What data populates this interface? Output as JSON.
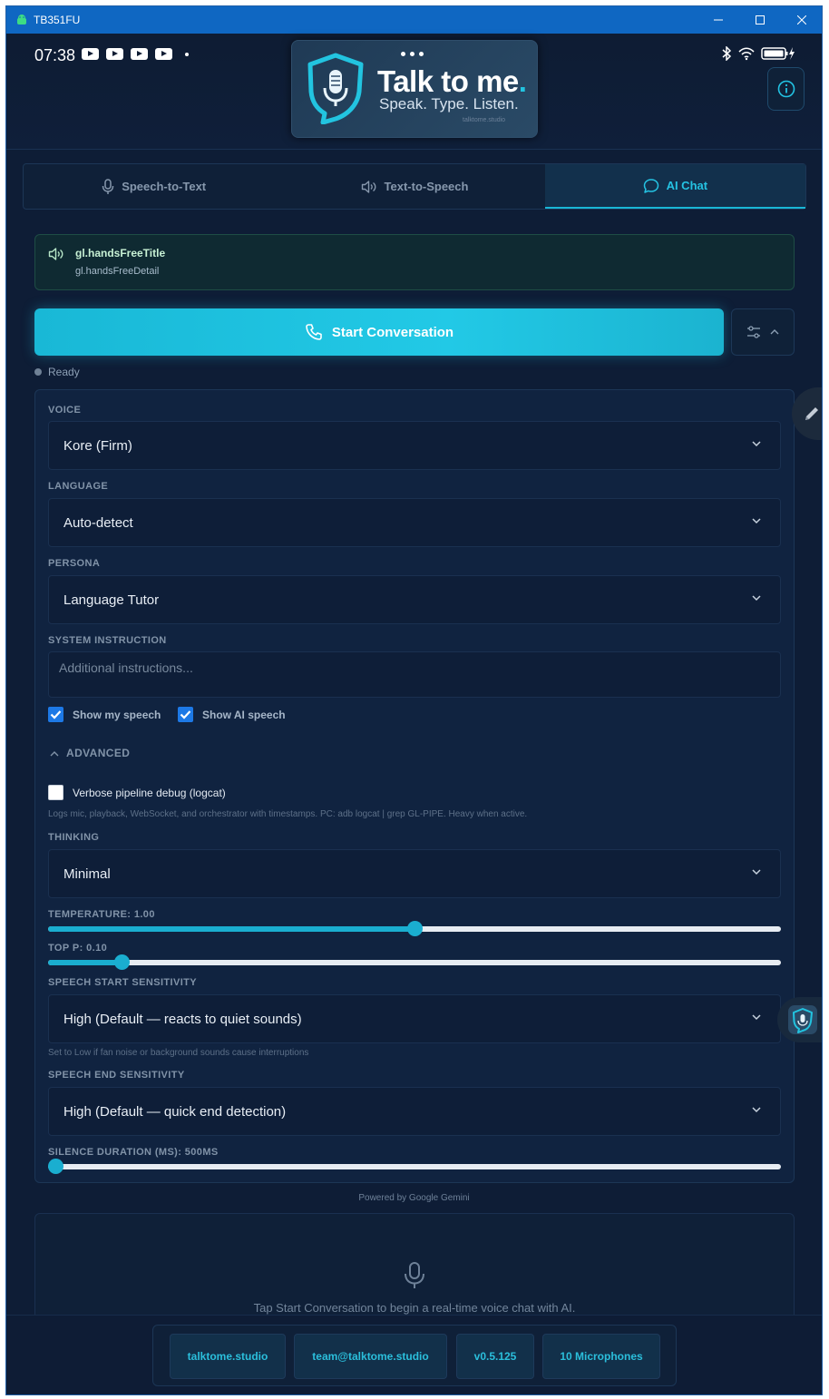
{
  "window": {
    "title": "TB351FU"
  },
  "status_bar": {
    "time": "07:38",
    "notification_icons": [
      "youtube-icon",
      "youtube-icon",
      "youtube-icon",
      "youtube-icon"
    ]
  },
  "logo": {
    "title": "Talk to me",
    "period": ".",
    "tagline": "Speak. Type. Listen.",
    "url": "talktome.studio"
  },
  "tabs": [
    {
      "label": "Speech-to-Text",
      "icon": "mic-icon"
    },
    {
      "label": "Text-to-Speech",
      "icon": "speaker-icon"
    },
    {
      "label": "AI Chat",
      "icon": "chat-bubble-icon",
      "active": true
    }
  ],
  "handsfree": {
    "title": "gl.handsFreeTitle",
    "detail": "gl.handsFreeDetail"
  },
  "start_button": {
    "label": "Start Conversation"
  },
  "status": {
    "text": "Ready"
  },
  "settings": {
    "voice_label": "VOICE",
    "voice_value": "Kore (Firm)",
    "language_label": "LANGUAGE",
    "language_value": "Auto-detect",
    "persona_label": "PERSONA",
    "persona_value": "Language Tutor",
    "system_instruction_label": "SYSTEM INSTRUCTION",
    "system_instruction_placeholder": "Additional instructions...",
    "show_my_speech": {
      "label": "Show my speech",
      "checked": true
    },
    "show_ai_speech": {
      "label": "Show AI speech",
      "checked": true
    },
    "advanced_label": "ADVANCED",
    "verbose": {
      "label": "Verbose pipeline debug (logcat)",
      "checked": false
    },
    "verbose_help": "Logs mic, playback, WebSocket, and orchestrator with timestamps. PC: adb logcat | grep GL-PIPE. Heavy when active.",
    "thinking_label": "THINKING",
    "thinking_value": "Minimal",
    "temperature_label": "TEMPERATURE: 1.00",
    "temperature_fraction": 0.5,
    "top_p_label": "TOP P: 0.10",
    "top_p_fraction": 0.1,
    "start_sensitivity_label": "SPEECH START SENSITIVITY",
    "start_sensitivity_value": "High (Default — reacts to quiet sounds)",
    "start_sensitivity_help": "Set to Low if fan noise or background sounds cause interruptions",
    "end_sensitivity_label": "SPEECH END SENSITIVITY",
    "end_sensitivity_value": "High (Default — quick end detection)",
    "silence_label": "SILENCE DURATION (MS): 500MS",
    "silence_fraction": 0.0
  },
  "powered_by": "Powered by Google Gemini",
  "empty_state": {
    "text": "Tap Start Conversation to begin a real-time voice chat with AI."
  },
  "footer": {
    "links": [
      "talktome.studio",
      "team@talktome.studio",
      "v0.5.125",
      "10 Microphones"
    ]
  },
  "colors": {
    "accent": "#22c3e3",
    "background": "#0e1d36",
    "titlebar": "#0f67c2",
    "checkbox": "#1d79e6"
  }
}
